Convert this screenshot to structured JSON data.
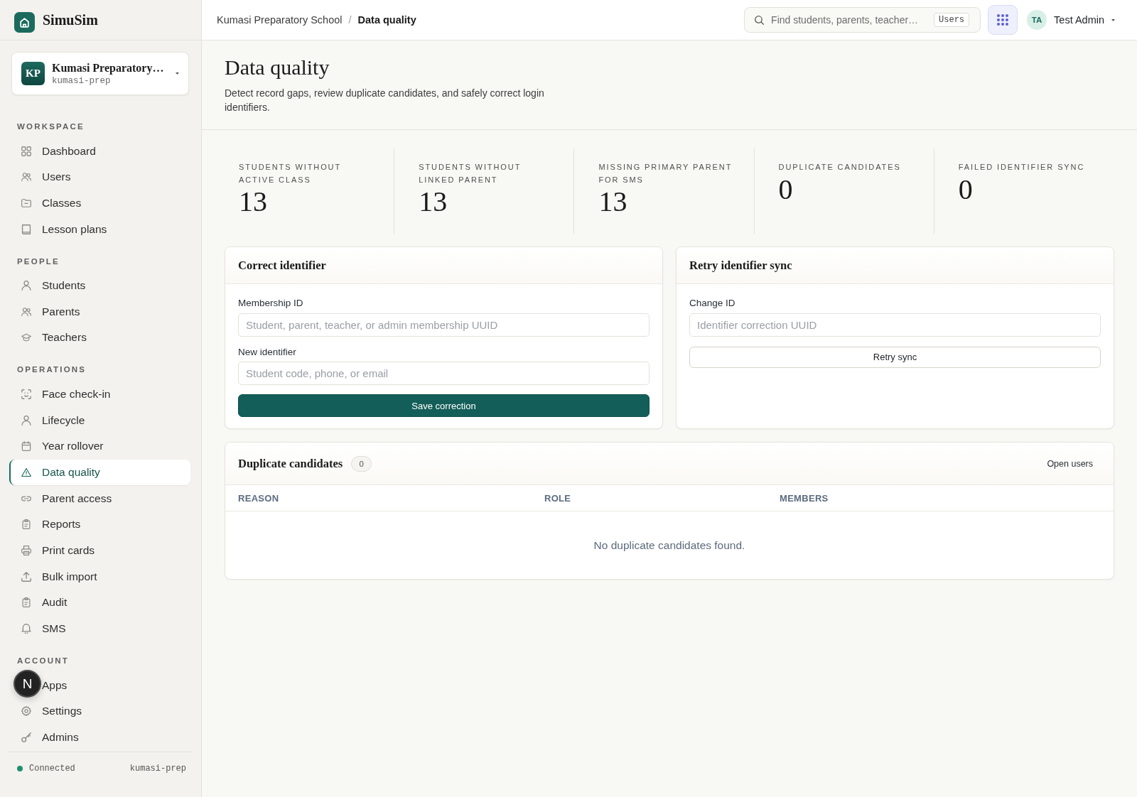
{
  "sidebar": {
    "brand": {
      "name": "SimuSim"
    },
    "org": {
      "initials": "KP",
      "name": "Kumasi Preparatory…",
      "slug": "kumasi-prep"
    },
    "sections": [
      {
        "title": "WORKSPACE",
        "items": [
          {
            "label": "Dashboard",
            "selected": false
          },
          {
            "label": "Users",
            "selected": false
          },
          {
            "label": "Classes",
            "selected": false
          },
          {
            "label": "Lesson plans",
            "selected": false
          }
        ]
      },
      {
        "title": "PEOPLE",
        "items": [
          {
            "label": "Students",
            "selected": false
          },
          {
            "label": "Parents",
            "selected": false
          },
          {
            "label": "Teachers",
            "selected": false
          }
        ]
      },
      {
        "title": "OPERATIONS",
        "items": [
          {
            "label": "Face check-in",
            "selected": false
          },
          {
            "label": "Lifecycle",
            "selected": false
          },
          {
            "label": "Year rollover",
            "selected": false
          },
          {
            "label": "Data quality",
            "selected": true
          },
          {
            "label": "Parent access",
            "selected": false
          },
          {
            "label": "Reports",
            "selected": false
          },
          {
            "label": "Print cards",
            "selected": false
          },
          {
            "label": "Bulk import",
            "selected": false
          },
          {
            "label": "Audit",
            "selected": false
          },
          {
            "label": "SMS",
            "selected": false
          }
        ]
      },
      {
        "title": "ACCOUNT",
        "items": [
          {
            "label": "Apps",
            "selected": false
          },
          {
            "label": "Settings",
            "selected": false
          },
          {
            "label": "Admins",
            "selected": false
          }
        ]
      }
    ],
    "status": {
      "label": "Connected",
      "connected": true,
      "slug": "kumasi-prep"
    }
  },
  "dev_tools": {
    "label": "N"
  },
  "topbar": {
    "breadcrumb": {
      "separator": "/",
      "items": [
        {
          "label": "Kumasi Preparatory School",
          "current": false
        },
        {
          "label": "Data quality",
          "current": true
        }
      ]
    },
    "search": {
      "placeholder": "Find students, parents, teacher…",
      "scope": "Users"
    },
    "user": {
      "initials": "TA",
      "name": "Test Admin"
    }
  },
  "page": {
    "title": "Data quality",
    "description": "Detect record gaps, review duplicate candidates, and safely correct login identifiers."
  },
  "stats": [
    {
      "label": "STUDENTS WITHOUT ACTIVE CLASS",
      "value": "13"
    },
    {
      "label": "STUDENTS WITHOUT LINKED PARENT",
      "value": "13"
    },
    {
      "label": "MISSING PRIMARY PARENT FOR SMS",
      "value": "13"
    },
    {
      "label": "DUPLICATE CANDIDATES",
      "value": "0"
    },
    {
      "label": "FAILED IDENTIFIER SYNC",
      "value": "0"
    }
  ],
  "forms": [
    {
      "title": "Correct identifier",
      "fields": [
        {
          "label": "Membership ID",
          "placeholder": "Student, parent, teacher, or admin membership UUID"
        },
        {
          "label": "New identifier",
          "placeholder": "Student code, phone, or email"
        }
      ],
      "button": {
        "label": "Save correction",
        "kind": "primary"
      }
    },
    {
      "title": "Retry identifier sync",
      "fields": [
        {
          "label": "Change ID",
          "placeholder": "Identifier correction UUID"
        }
      ],
      "button": {
        "label": "Retry sync",
        "kind": "secondary"
      }
    }
  ],
  "duplicates": {
    "title": "Duplicate candidates",
    "count": "0",
    "link": "Open users",
    "columns": [
      "REASON",
      "ROLE",
      "MEMBERS"
    ],
    "empty_message": "No duplicate candidates found."
  }
}
